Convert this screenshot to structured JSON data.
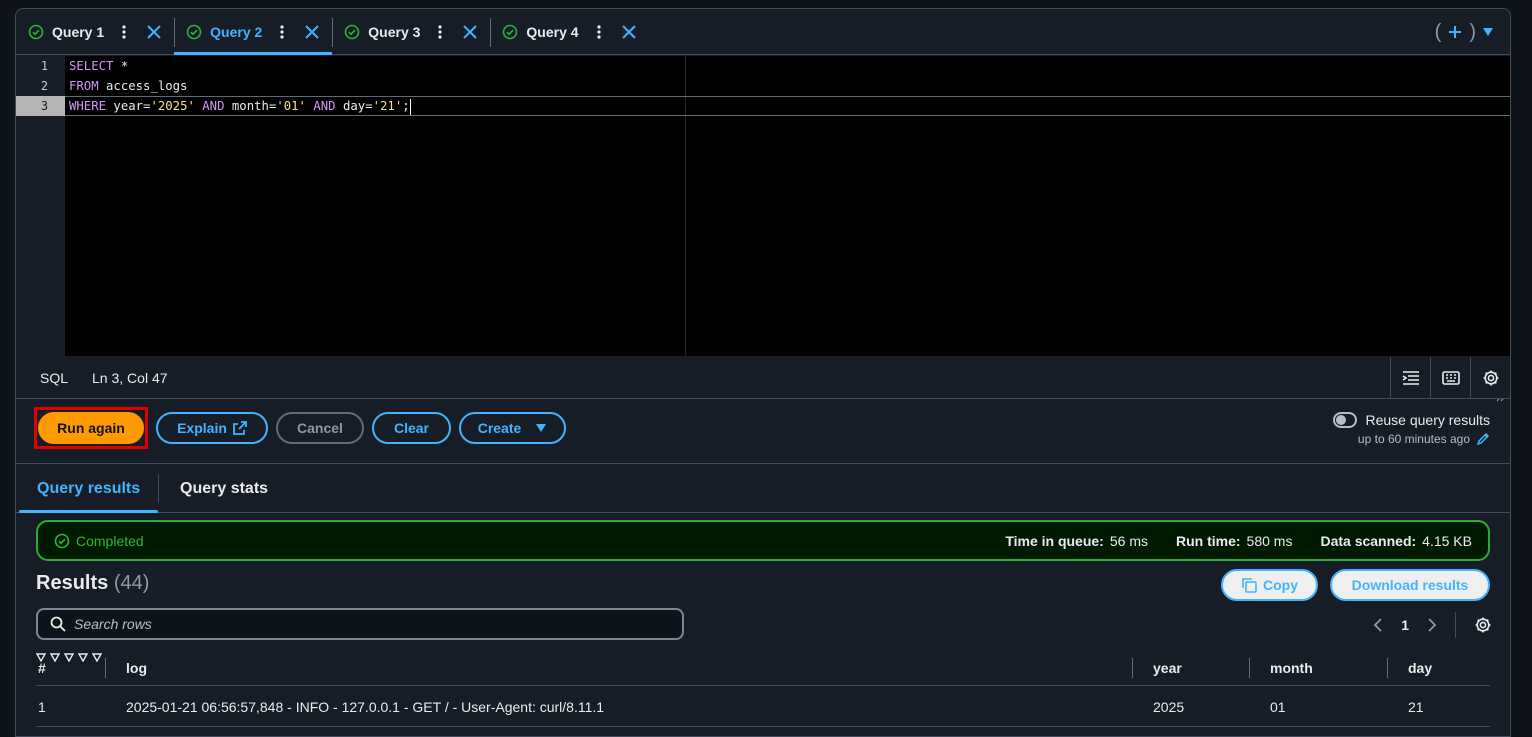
{
  "tabs": [
    {
      "label": "Query 1",
      "active": false
    },
    {
      "label": "Query 2",
      "active": true
    },
    {
      "label": "Query 3",
      "active": false
    },
    {
      "label": "Query 4",
      "active": false
    }
  ],
  "editor": {
    "line_numbers": [
      "1",
      "2",
      "3"
    ],
    "lines": [
      {
        "text": "SELECT *"
      },
      {
        "text": "FROM access_logs"
      },
      {
        "text": "WHERE year='2025' AND month='01' AND day='21';"
      }
    ]
  },
  "status": {
    "language": "SQL",
    "position": "Ln 3, Col 47"
  },
  "actions": {
    "run_again": "Run again",
    "explain": "Explain",
    "cancel": "Cancel",
    "clear": "Clear",
    "create": "Create",
    "reuse_label": "Reuse query results",
    "reuse_sub": "up to 60 minutes ago"
  },
  "result_tabs": {
    "results": "Query results",
    "stats": "Query stats"
  },
  "banner": {
    "status": "Completed",
    "queue_label": "Time in queue:",
    "queue_value": "56 ms",
    "run_label": "Run time:",
    "run_value": "580 ms",
    "scanned_label": "Data scanned:",
    "scanned_value": "4.15 KB"
  },
  "results": {
    "title": "Results",
    "count": "(44)",
    "copy": "Copy",
    "download": "Download results",
    "search_placeholder": "Search rows",
    "page": "1"
  },
  "table": {
    "headers": [
      "#",
      "log",
      "year",
      "month",
      "day"
    ],
    "rows": [
      [
        "1",
        "2025-01-21 06:56:57,848 - INFO - 127.0.0.1 - GET / - User-Agent: curl/8.11.1",
        "2025",
        "01",
        "21"
      ]
    ]
  },
  "colors": {
    "accent": "#42b4ff",
    "primary": "#ff9900",
    "success": "#29ad32",
    "highlight": "#e00000"
  }
}
